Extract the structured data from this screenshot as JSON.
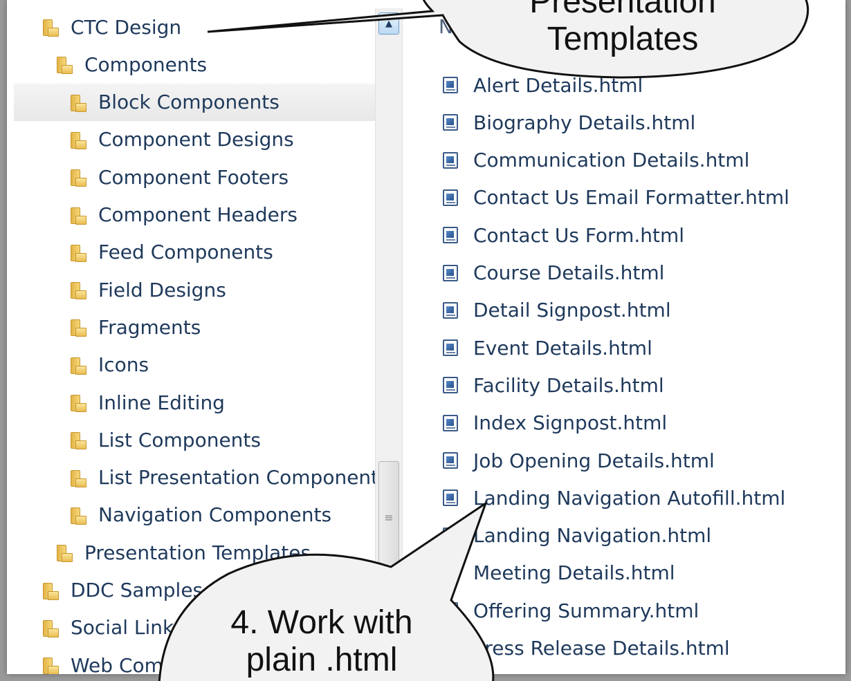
{
  "folder_tree": [
    {
      "label": "CTC Design",
      "level": 0
    },
    {
      "label": "Components",
      "level": 1
    },
    {
      "label": "Block Components",
      "level": 2,
      "selected": true
    },
    {
      "label": "Component Designs",
      "level": 2
    },
    {
      "label": "Component Footers",
      "level": 2
    },
    {
      "label": "Component Headers",
      "level": 2
    },
    {
      "label": "Feed Components",
      "level": 2
    },
    {
      "label": "Field Designs",
      "level": 2
    },
    {
      "label": "Fragments",
      "level": 2
    },
    {
      "label": "Icons",
      "level": 2
    },
    {
      "label": "Inline Editing",
      "level": 2
    },
    {
      "label": "List Components",
      "level": 2
    },
    {
      "label": "List Presentation Components",
      "level": 2
    },
    {
      "label": "Navigation Components",
      "level": 2
    },
    {
      "label": "Presentation Templates",
      "level": 1
    },
    {
      "label": "DDC Samples",
      "level": 0
    },
    {
      "label": "Social Links",
      "level": 0
    },
    {
      "label": "Web Components",
      "level": 0
    }
  ],
  "file_list": {
    "column_header": "Name",
    "items": [
      "Alert Details.html",
      "Biography Details.html",
      "Communication Details.html",
      "Contact Us Email Formatter.html",
      "Contact Us Form.html",
      "Course Details.html",
      "Detail Signpost.html",
      "Event Details.html",
      "Facility Details.html",
      "Index Signpost.html",
      "Job Opening Details.html",
      "Landing Navigation Autofill.html",
      "Landing Navigation.html",
      "Meeting Details.html",
      "Offering Summary.html",
      "Press Release Details.html"
    ]
  },
  "callouts": {
    "top": {
      "lines": [
        "Presentation",
        "Templates"
      ]
    },
    "bottom": {
      "lines": [
        "4. Work with",
        "plain .html"
      ]
    }
  },
  "icons": {
    "folder": "folder-icon",
    "file": "html-file-icon",
    "scroll_up": "scroll-up-arrow-icon",
    "scroll_grip": "scroll-grip-icon"
  },
  "colors": {
    "text": "#1e395b",
    "selection": "#e9e9e9",
    "folder": "#e3b448",
    "callout_fill": "#f2f2f2",
    "callout_stroke": "#111111"
  }
}
